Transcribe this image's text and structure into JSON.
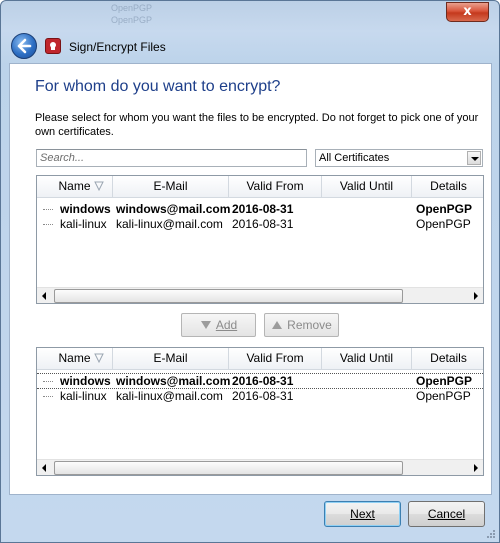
{
  "titlebar": {
    "ghost_text": [
      "OpenPGP",
      "OpenPGP"
    ],
    "close_label": "x"
  },
  "nav": {
    "title": "Sign/Encrypt Files"
  },
  "page": {
    "heading": "For whom do you want to encrypt?",
    "instructions": "Please select for whom you want the files to be encrypted. Do not forget to pick one of your own certificates."
  },
  "search": {
    "placeholder": "Search...",
    "value": ""
  },
  "filter": {
    "selected": "All Certificates"
  },
  "columns": [
    "Name",
    "E-Mail",
    "Valid From",
    "Valid Until",
    "Details"
  ],
  "available_table": {
    "rows": [
      {
        "name": "windows",
        "email": "windows@mail.com",
        "valid_from": "2016-08-31",
        "valid_until": "",
        "details": "OpenPGP"
      },
      {
        "name": "kali-linux",
        "email": "kali-linux@mail.com",
        "valid_from": "2016-08-31",
        "valid_until": "",
        "details": "OpenPGP"
      }
    ]
  },
  "recipients_table": {
    "rows": [
      {
        "name": "windows",
        "email": "windows@mail.com",
        "valid_from": "2016-08-31",
        "valid_until": "",
        "details": "OpenPGP"
      },
      {
        "name": "kali-linux",
        "email": "kali-linux@mail.com",
        "valid_from": "2016-08-31",
        "valid_until": "",
        "details": "OpenPGP"
      }
    ]
  },
  "buttons": {
    "add": "Add",
    "remove": "Remove",
    "next": "Next",
    "cancel": "Cancel"
  },
  "colors": {
    "heading": "#1e3f8a",
    "window_frame": "#c4d8ee",
    "close_button": "#c4391d"
  }
}
